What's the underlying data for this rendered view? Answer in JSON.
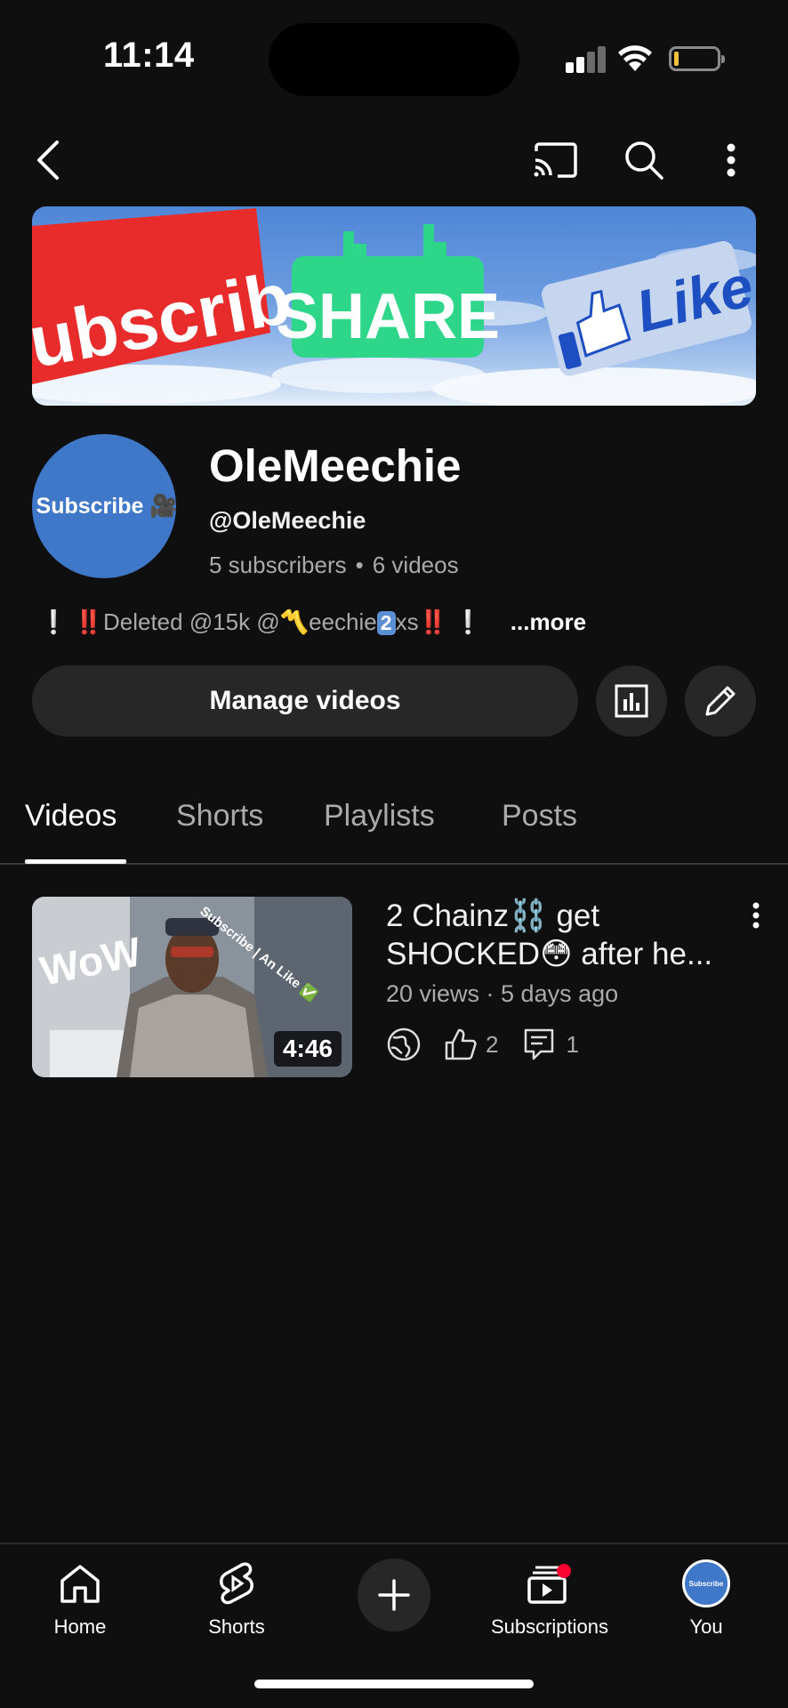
{
  "status_bar": {
    "time": "11:14"
  },
  "banner": {
    "subscribe_text": "ubscribe",
    "share_text": "SHARE",
    "like_text": "Like"
  },
  "channel": {
    "avatar_text": "Subscribe 🎥",
    "name": "OleMeechie",
    "handle": "@OleMeechie",
    "subscribers": "5 subscribers",
    "separator": "•",
    "videos_count": "6 videos",
    "bio": {
      "excl1": "❕",
      "excl2": "‼️",
      "text1": "Deleted @15k @",
      "crown": "〽️",
      "text2": "eechie",
      "key": "2",
      "text3": "xs",
      "excl3": "‼️",
      "excl4": "❕",
      "more": "...more"
    }
  },
  "actions": {
    "manage_videos": "Manage videos"
  },
  "tabs": [
    {
      "label": "Videos",
      "active": true
    },
    {
      "label": "Shorts",
      "active": false
    },
    {
      "label": "Playlists",
      "active": false
    },
    {
      "label": "Posts",
      "active": false
    }
  ],
  "videos": [
    {
      "title": "2 Chainz⛓️ get SHOCKED😳 after he...",
      "meta": "20 views · 5 days ago",
      "duration": "4:46",
      "likes": "2",
      "comments": "1",
      "thumb_wow": "WoW",
      "thumb_overlay": "Subscribe | An Like ✅"
    }
  ],
  "bottom_nav": {
    "home": "Home",
    "shorts": "Shorts",
    "subscriptions": "Subscriptions",
    "you": "You",
    "you_avatar_text": "Subscribe"
  },
  "colors": {
    "background": "#0f0f0f",
    "surface": "#272727",
    "accent_red": "#ff0033",
    "muted_text": "#aaaaaa"
  }
}
